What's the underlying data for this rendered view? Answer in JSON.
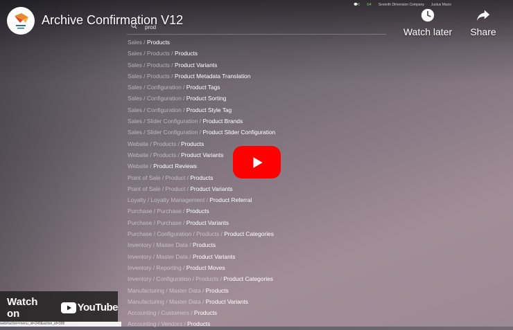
{
  "video": {
    "title": "Archive Confirmation V12"
  },
  "actions": {
    "watch_later": "Watch later",
    "share": "Share"
  },
  "footer": {
    "watch_on": "Watch on",
    "youtube": "YouTube"
  },
  "odoo_topbar": {
    "badge_a": "6",
    "badge_b": "4",
    "company": "Seventh Dimension Company",
    "user": "Justus Macio"
  },
  "search": {
    "value": "prod"
  },
  "results": [
    {
      "path": "Sales / ",
      "leaf": "Products"
    },
    {
      "path": "Sales / Products / ",
      "leaf": "Products"
    },
    {
      "path": "Sales / Products / ",
      "leaf": "Product Variants"
    },
    {
      "path": "Sales / Products / ",
      "leaf": "Product Metadata Translation"
    },
    {
      "path": "Sales / Configuration / ",
      "leaf": "Product Tags"
    },
    {
      "path": "Sales / Configuration / ",
      "leaf": "Product Sorting"
    },
    {
      "path": "Sales / Configuration / ",
      "leaf": "Product Style Tag"
    },
    {
      "path": "Sales / Slider Configuration / ",
      "leaf": "Product Brands"
    },
    {
      "path": "Sales / Slider Configuration / ",
      "leaf": "Product Slider Configuration"
    },
    {
      "path": "Website / Products / ",
      "leaf": "Products"
    },
    {
      "path": "Website / Products / ",
      "leaf": "Product Variants"
    },
    {
      "path": "Website / ",
      "leaf": "Product Reviews"
    },
    {
      "path": "Point of Sale / Product / ",
      "leaf": "Products"
    },
    {
      "path": "Point of Sale / Product / ",
      "leaf": "Product Variants"
    },
    {
      "path": "Loyalty / Loyalty Management / ",
      "leaf": "Product Referral"
    },
    {
      "path": "Purchase / Purchase / ",
      "leaf": "Products"
    },
    {
      "path": "Purchase / Purchase / ",
      "leaf": "Product Variants"
    },
    {
      "path": "Purchase / Configuration / Products / ",
      "leaf": "Product Categories"
    },
    {
      "path": "Inventory / Master Data / ",
      "leaf": "Products"
    },
    {
      "path": "Inventory / Master Data / ",
      "leaf": "Product Variants"
    },
    {
      "path": "Inventory / Reporting / ",
      "leaf": "Product Moves"
    },
    {
      "path": "Inventory / Configuration / Products / ",
      "leaf": "Product Categories"
    },
    {
      "path": "Manufacturing / Master Data / ",
      "leaf": "Products"
    },
    {
      "path": "Manufacturing / Master Data / ",
      "leaf": "Product Variants"
    },
    {
      "path": "Accounting / Customers / ",
      "leaf": "Products"
    },
    {
      "path": "Accounting / Vendors / ",
      "leaf": "Products"
    }
  ],
  "status_url": "web#action=menu_id=240&action_id=395"
}
